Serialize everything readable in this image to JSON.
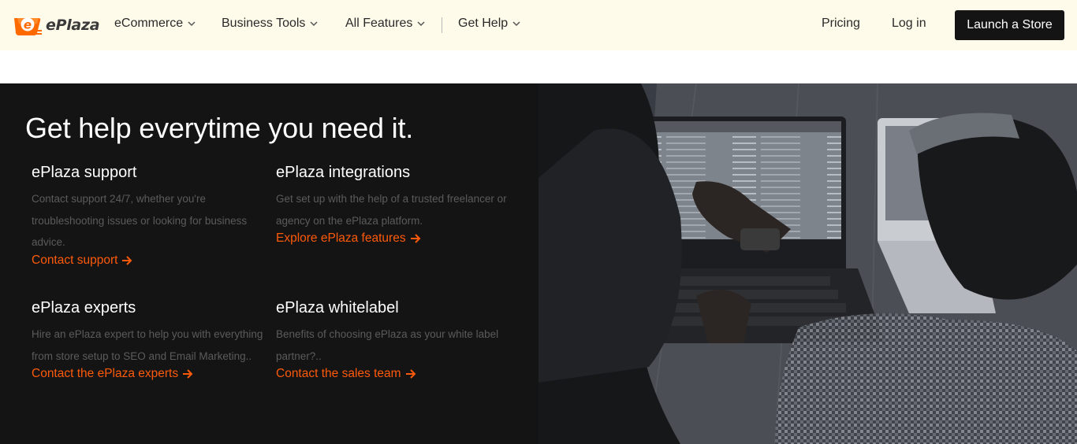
{
  "nav": {
    "brand": "ePlaza",
    "items": [
      {
        "label": "eCommerce"
      },
      {
        "label": "Business Tools"
      },
      {
        "label": "All Features"
      },
      {
        "label": "Get Help"
      }
    ],
    "pricing": "Pricing",
    "login": "Log in",
    "cta": "Launch a Store"
  },
  "help": {
    "title": "Get help everytime you need it.",
    "cards": [
      {
        "title": "ePlaza support",
        "body": "Contact support 24/7, whether you're troubleshooting issues or looking for business advice.",
        "link": "Contact support"
      },
      {
        "title": "ePlaza integrations",
        "body": "Get set up with the help of a trusted freelancer or agency on the ePlaza platform.",
        "link": "Explore ePlaza features"
      },
      {
        "title": "ePlaza experts",
        "body": "Hire an ePlaza expert to help you with everything from store setup to SEO and Email Marketing..",
        "link": "Contact the ePlaza experts"
      },
      {
        "title": "ePlaza whitelabel",
        "body": "Benefits of choosing ePlaza as your white label partner?..",
        "link": "Contact the sales team"
      }
    ]
  },
  "icons": {
    "logo": "shopping-bag-logo-icon",
    "dropdown": "chevron-down-icon",
    "link_arrow": "arrow-right-icon"
  },
  "colors": {
    "nav_bg": "#fffbea",
    "section_bg": "#141414",
    "accent": "#ff5a0a",
    "cta_bg": "#141414"
  }
}
